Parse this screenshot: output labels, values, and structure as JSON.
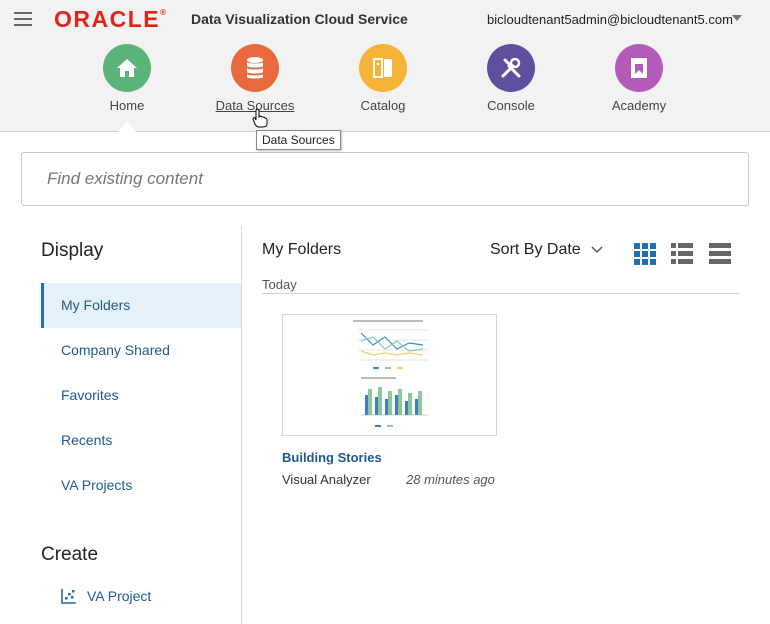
{
  "header": {
    "logo_text": "ORACLE",
    "logo_mark": "®",
    "app_title": "Data Visualization Cloud Service",
    "user": "bicloudtenant5admin@bicloudtenant5.com"
  },
  "nav": {
    "items": [
      {
        "label": "Home",
        "icon": "home-icon",
        "color": "#5ab47a"
      },
      {
        "label": "Data Sources",
        "icon": "database-icon",
        "color": "#e8693c"
      },
      {
        "label": "Catalog",
        "icon": "catalog-icon",
        "color": "#f5b33a"
      },
      {
        "label": "Console",
        "icon": "tools-icon",
        "color": "#5f4f9e"
      },
      {
        "label": "Academy",
        "icon": "academy-icon",
        "color": "#b45ab8"
      }
    ],
    "tooltip": "Data Sources"
  },
  "search": {
    "placeholder": "Find existing content"
  },
  "sidebar": {
    "display_heading": "Display",
    "items": [
      {
        "label": "My Folders",
        "active": true
      },
      {
        "label": "Company Shared"
      },
      {
        "label": "Favorites"
      },
      {
        "label": "Recents"
      },
      {
        "label": "VA Projects"
      }
    ],
    "create_heading": "Create",
    "create_items": [
      {
        "label": "VA Project",
        "icon": "scatter-chart-icon"
      }
    ]
  },
  "main": {
    "title": "My Folders",
    "sort_label": "Sort By Date",
    "views": [
      "grid-view-icon",
      "list-view-icon",
      "detail-view-icon"
    ],
    "active_view": "grid-view-icon",
    "section": "Today",
    "cards": [
      {
        "title": "Building Stories",
        "type": "Visual Analyzer",
        "time": "28 minutes ago"
      }
    ]
  },
  "colors": {
    "accent": "#1f6fb2",
    "link": "#1f5a8f",
    "oracle_red": "#e2231a"
  }
}
